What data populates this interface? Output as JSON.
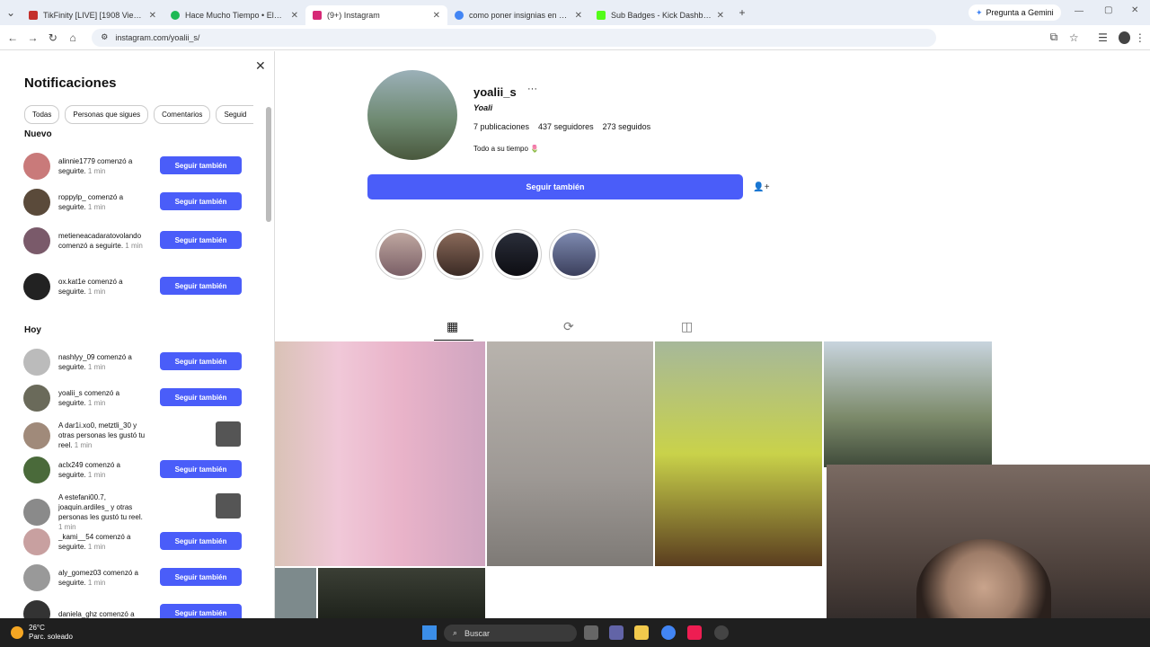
{
  "browser": {
    "tabs": [
      {
        "title": "TikFinity [LIVE] [1908 Viewers]",
        "color": "#c4302b"
      },
      {
        "title": "Hace Mucho Tiempo • Ele A",
        "color": "#1db954"
      },
      {
        "title": "(9+) Instagram",
        "color": "#d62976",
        "active": true
      },
      {
        "title": "como poner insignias en kick -",
        "color": "#4285f4"
      },
      {
        "title": "Sub Badges - Kick Dashboard",
        "color": "#53fc18"
      }
    ],
    "gemini": "Pregunta a Gemini",
    "url": "instagram.com/yoalii_s/"
  },
  "notifications": {
    "title": "Notificaciones",
    "filters": [
      "Todas",
      "Personas que sigues",
      "Comentarios",
      "Seguid"
    ],
    "section_new": "Nuevo",
    "section_today": "Hoy",
    "follow_back_label": "Seguir también",
    "new_items": [
      {
        "user": "alinnie1779",
        "text": " comenzó a seguirte.",
        "time": "1 min",
        "button": true
      },
      {
        "user": "roppylp_",
        "text": " comenzó a seguirte.",
        "time": "1 min",
        "button": true
      },
      {
        "user": "metieneacadaratovolando",
        "text": " comenzó a seguirte.",
        "time": "1 min",
        "button": true
      },
      {
        "user": "ox.kat1e",
        "text": " comenzó a seguirte.",
        "time": "1 min",
        "button": true
      }
    ],
    "today_items": [
      {
        "user": "nashlyy_09",
        "text": " comenzó a seguirte.",
        "time": "1 min",
        "button": true
      },
      {
        "user": "yoalii_s",
        "text": " comenzó a seguirte.",
        "time": "1 min",
        "button": true
      },
      {
        "user": "A dar1i.xo0, metztli_30",
        "text": " y otras personas les gustó tu reel.",
        "time": "1 min",
        "button": false
      },
      {
        "user": "aclx249",
        "text": " comenzó a seguirte.",
        "time": "1 min",
        "button": true
      },
      {
        "user": "A estefani00.7, joaquin.ardiles_",
        "text": " y otras personas les gustó tu reel.",
        "time": "1 min",
        "button": false
      },
      {
        "user": "_kami__54",
        "text": " comenzó a seguirte.",
        "time": "1 min",
        "button": true
      },
      {
        "user": "aly_gomez03",
        "text": " comenzó a seguirte.",
        "time": "1 min",
        "button": true
      },
      {
        "user": "daniela_ghz",
        "text": " comenzó a",
        "time": "",
        "button": true
      }
    ]
  },
  "profile": {
    "username": "yoalii_s",
    "more": "···",
    "name": "Yoali",
    "posts": "7 publicaciones",
    "followers": "437 seguidores",
    "following": "273 seguidos",
    "bio": "Todo a su tiempo 🌷",
    "follow_button": "Seguir también"
  },
  "taskbar": {
    "temp": "26°C",
    "weather": "Parc. soleado",
    "search": "Buscar"
  }
}
